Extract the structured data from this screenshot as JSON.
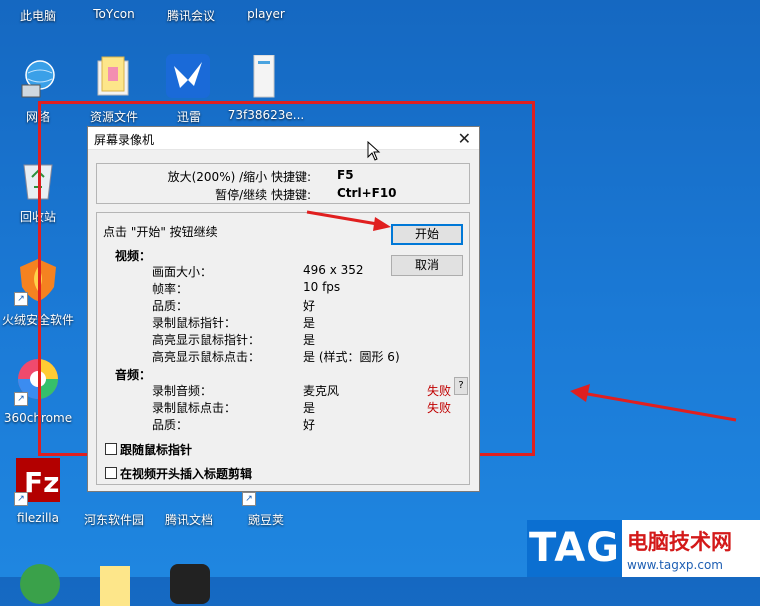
{
  "desktop": {
    "icons": [
      {
        "label": "此电脑"
      },
      {
        "label": "ToYcon"
      },
      {
        "label": "腾讯会议"
      },
      {
        "label": "player"
      },
      {
        "label": "网络"
      },
      {
        "label": "资源文件"
      },
      {
        "label": "迅雷"
      },
      {
        "label": "73f38623e..."
      },
      {
        "label": "回收站"
      },
      {
        "label": "火绒安全软件"
      },
      {
        "label": "360chrome"
      },
      {
        "label": "filezilla"
      },
      {
        "label": "河东软件园"
      },
      {
        "label": "腾讯文档"
      },
      {
        "label": "豌豆荚"
      }
    ]
  },
  "dialog": {
    "title": "屏幕录像机",
    "close_glyph": "✕",
    "hotkeys": [
      {
        "label": "放大(200%) /缩小 快捷键:",
        "key": "F5"
      },
      {
        "label": "暂停/继续 快捷键:",
        "key": "Ctrl+F10"
      }
    ],
    "hint": "点击 \"开始\" 按钮继续",
    "start_label": "开始",
    "cancel_label": "取消",
    "video": {
      "heading": "视频：",
      "rows": [
        {
          "label": "画面大小：",
          "value": "496 x 352"
        },
        {
          "label": "帧率：",
          "value": "10 fps"
        },
        {
          "label": "品质：",
          "value": "好"
        },
        {
          "label": "录制鼠标指针：",
          "value": "是"
        },
        {
          "label": "高亮显示鼠标指针：",
          "value": "是"
        },
        {
          "label": "高亮显示鼠标点击：",
          "value": "是 (样式：圆形 6)"
        }
      ]
    },
    "audio": {
      "heading": "音频：",
      "rows": [
        {
          "label": "录制音频：",
          "value": "麦克风",
          "status": "失败"
        },
        {
          "label": "录制鼠标点击：",
          "value": "是",
          "status": "失败"
        },
        {
          "label": "品质：",
          "value": "好"
        }
      ],
      "help_label": "?"
    },
    "checkboxes": [
      {
        "label": "跟随鼠标指针",
        "checked": false
      },
      {
        "label": "在视频开头插入标题剪辑",
        "checked": false
      }
    ]
  },
  "watermark": {
    "logo_text": "TAG",
    "site_name": "电脑技术网",
    "site_url": "www.tagxp.com"
  },
  "colors": {
    "desktop": "#1b7ad6",
    "selection": "#e01f1f",
    "fail": "#c00000",
    "accent": "#0078d7"
  }
}
